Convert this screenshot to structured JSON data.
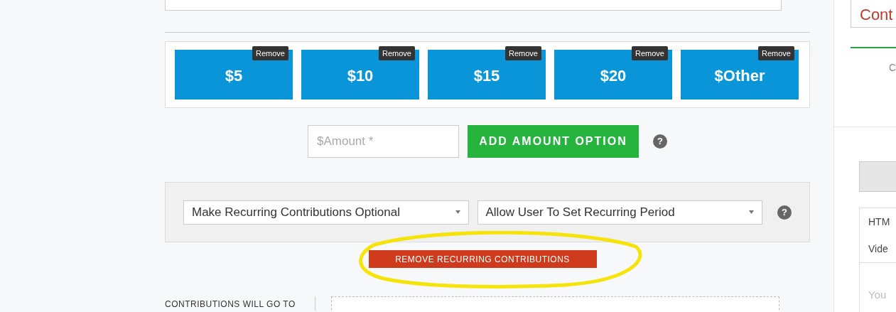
{
  "amount_options": [
    {
      "label": "$5",
      "remove": "Remove"
    },
    {
      "label": "$10",
      "remove": "Remove"
    },
    {
      "label": "$15",
      "remove": "Remove"
    },
    {
      "label": "$20",
      "remove": "Remove"
    },
    {
      "label": "$Other",
      "remove": "Remove"
    }
  ],
  "amount_input": {
    "placeholder": "$Amount *"
  },
  "add_button": "ADD AMOUNT OPTION",
  "add_help": "?",
  "recurring_help": "?",
  "recurring": {
    "options_select": "Make Recurring Contributions Optional",
    "period_select": "Allow User To Set Recurring Period"
  },
  "remove_recurring_button": "REMOVE RECURRING CONTRIBUTIONS",
  "contributions_label": "CONTRIBUTIONS WILL GO TO",
  "side_panel": {
    "title_field": "Cont",
    "tab_label": "C",
    "list_items": [
      "HTM",
      "Vide"
    ],
    "text_placeholder": "You"
  }
}
